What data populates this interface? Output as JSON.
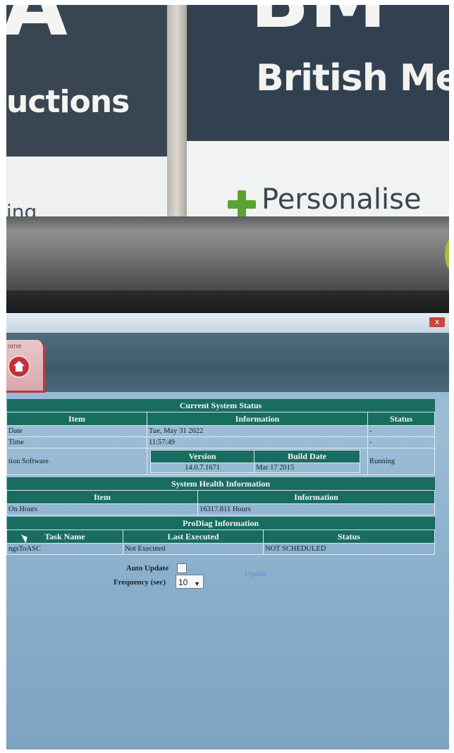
{
  "signage": {
    "left_large_letter": "A",
    "left_word": "uctions",
    "left_strip_word": "ing",
    "right_large_letters": "BM",
    "right_line1": "British Med",
    "right_line2": "Personalise"
  },
  "window": {
    "close_label": "x",
    "home_tab_label": "ome"
  },
  "current_status": {
    "title": "Current System Status",
    "headers": [
      "Item",
      "Information",
      "Status"
    ],
    "rows": [
      {
        "item": "Date",
        "info": "Tue, May 31 2022",
        "status": "-"
      },
      {
        "item": "Time",
        "info": "11:57:49",
        "status": "-"
      },
      {
        "item": "tion Software",
        "version_label": "Version",
        "build_label": "Build Date",
        "version": "14.0.7.1671",
        "build": "Mar 17 2015",
        "status": "Running"
      }
    ]
  },
  "system_health": {
    "title": "System Health Information",
    "headers": [
      "Item",
      "Information"
    ],
    "row": {
      "item": "On Hours",
      "info": "16317.811 Hours"
    }
  },
  "prodiag": {
    "title": "ProDiag Information",
    "headers": [
      "Task Name",
      "Last Executed",
      "Status"
    ],
    "row": {
      "task": "ngsToASC",
      "last": "Not Executed",
      "status": "NOT SCHEDULED"
    }
  },
  "controls": {
    "auto_update_label": "Auto Update",
    "frequency_label": "Frequency (sec)",
    "frequency_value": "10",
    "update_link": "Update"
  },
  "colors": {
    "table_header": "#196c60",
    "screen_bg": "#8fb2cc"
  }
}
